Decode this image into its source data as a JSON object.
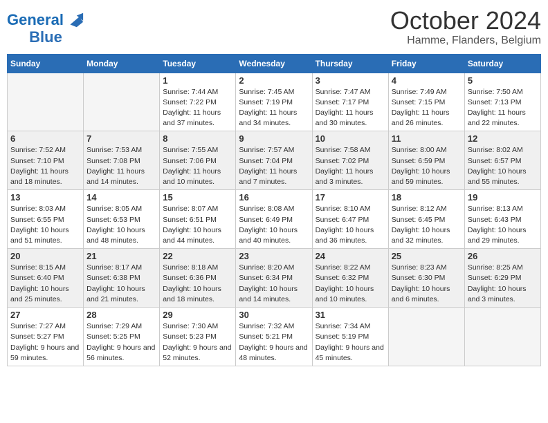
{
  "logo": {
    "line1": "General",
    "line2": "Blue"
  },
  "title": "October 2024",
  "location": "Hamme, Flanders, Belgium",
  "days_of_week": [
    "Sunday",
    "Monday",
    "Tuesday",
    "Wednesday",
    "Thursday",
    "Friday",
    "Saturday"
  ],
  "weeks": [
    [
      {
        "day": "",
        "empty": true
      },
      {
        "day": "",
        "empty": true
      },
      {
        "day": "1",
        "sunrise": "7:44 AM",
        "sunset": "7:22 PM",
        "daylight": "11 hours and 37 minutes."
      },
      {
        "day": "2",
        "sunrise": "7:45 AM",
        "sunset": "7:19 PM",
        "daylight": "11 hours and 34 minutes."
      },
      {
        "day": "3",
        "sunrise": "7:47 AM",
        "sunset": "7:17 PM",
        "daylight": "11 hours and 30 minutes."
      },
      {
        "day": "4",
        "sunrise": "7:49 AM",
        "sunset": "7:15 PM",
        "daylight": "11 hours and 26 minutes."
      },
      {
        "day": "5",
        "sunrise": "7:50 AM",
        "sunset": "7:13 PM",
        "daylight": "11 hours and 22 minutes."
      }
    ],
    [
      {
        "day": "6",
        "sunrise": "7:52 AM",
        "sunset": "7:10 PM",
        "daylight": "11 hours and 18 minutes."
      },
      {
        "day": "7",
        "sunrise": "7:53 AM",
        "sunset": "7:08 PM",
        "daylight": "11 hours and 14 minutes."
      },
      {
        "day": "8",
        "sunrise": "7:55 AM",
        "sunset": "7:06 PM",
        "daylight": "11 hours and 10 minutes."
      },
      {
        "day": "9",
        "sunrise": "7:57 AM",
        "sunset": "7:04 PM",
        "daylight": "11 hours and 7 minutes."
      },
      {
        "day": "10",
        "sunrise": "7:58 AM",
        "sunset": "7:02 PM",
        "daylight": "11 hours and 3 minutes."
      },
      {
        "day": "11",
        "sunrise": "8:00 AM",
        "sunset": "6:59 PM",
        "daylight": "10 hours and 59 minutes."
      },
      {
        "day": "12",
        "sunrise": "8:02 AM",
        "sunset": "6:57 PM",
        "daylight": "10 hours and 55 minutes."
      }
    ],
    [
      {
        "day": "13",
        "sunrise": "8:03 AM",
        "sunset": "6:55 PM",
        "daylight": "10 hours and 51 minutes."
      },
      {
        "day": "14",
        "sunrise": "8:05 AM",
        "sunset": "6:53 PM",
        "daylight": "10 hours and 48 minutes."
      },
      {
        "day": "15",
        "sunrise": "8:07 AM",
        "sunset": "6:51 PM",
        "daylight": "10 hours and 44 minutes."
      },
      {
        "day": "16",
        "sunrise": "8:08 AM",
        "sunset": "6:49 PM",
        "daylight": "10 hours and 40 minutes."
      },
      {
        "day": "17",
        "sunrise": "8:10 AM",
        "sunset": "6:47 PM",
        "daylight": "10 hours and 36 minutes."
      },
      {
        "day": "18",
        "sunrise": "8:12 AM",
        "sunset": "6:45 PM",
        "daylight": "10 hours and 32 minutes."
      },
      {
        "day": "19",
        "sunrise": "8:13 AM",
        "sunset": "6:43 PM",
        "daylight": "10 hours and 29 minutes."
      }
    ],
    [
      {
        "day": "20",
        "sunrise": "8:15 AM",
        "sunset": "6:40 PM",
        "daylight": "10 hours and 25 minutes."
      },
      {
        "day": "21",
        "sunrise": "8:17 AM",
        "sunset": "6:38 PM",
        "daylight": "10 hours and 21 minutes."
      },
      {
        "day": "22",
        "sunrise": "8:18 AM",
        "sunset": "6:36 PM",
        "daylight": "10 hours and 18 minutes."
      },
      {
        "day": "23",
        "sunrise": "8:20 AM",
        "sunset": "6:34 PM",
        "daylight": "10 hours and 14 minutes."
      },
      {
        "day": "24",
        "sunrise": "8:22 AM",
        "sunset": "6:32 PM",
        "daylight": "10 hours and 10 minutes."
      },
      {
        "day": "25",
        "sunrise": "8:23 AM",
        "sunset": "6:30 PM",
        "daylight": "10 hours and 6 minutes."
      },
      {
        "day": "26",
        "sunrise": "8:25 AM",
        "sunset": "6:29 PM",
        "daylight": "10 hours and 3 minutes."
      }
    ],
    [
      {
        "day": "27",
        "sunrise": "7:27 AM",
        "sunset": "5:27 PM",
        "daylight": "9 hours and 59 minutes."
      },
      {
        "day": "28",
        "sunrise": "7:29 AM",
        "sunset": "5:25 PM",
        "daylight": "9 hours and 56 minutes."
      },
      {
        "day": "29",
        "sunrise": "7:30 AM",
        "sunset": "5:23 PM",
        "daylight": "9 hours and 52 minutes."
      },
      {
        "day": "30",
        "sunrise": "7:32 AM",
        "sunset": "5:21 PM",
        "daylight": "9 hours and 48 minutes."
      },
      {
        "day": "31",
        "sunrise": "7:34 AM",
        "sunset": "5:19 PM",
        "daylight": "9 hours and 45 minutes."
      },
      {
        "day": "",
        "empty": true
      },
      {
        "day": "",
        "empty": true
      }
    ]
  ]
}
